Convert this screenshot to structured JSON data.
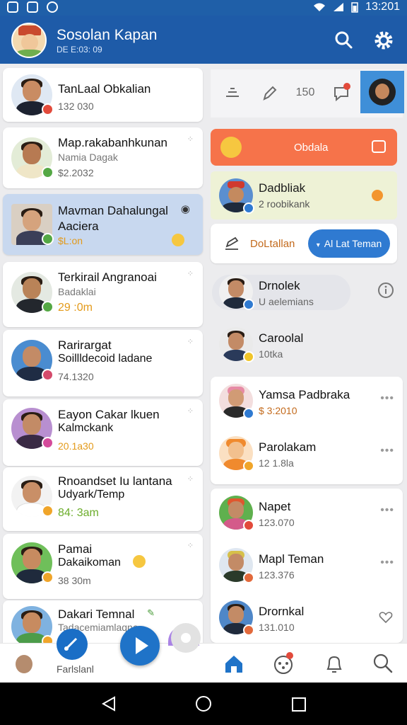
{
  "status": {
    "time": "13:201"
  },
  "header": {
    "title": "Sosolan Kapan",
    "subtitle": "DE E:03: 09"
  },
  "left_list": [
    {
      "name": "TanLaal Obkalian",
      "meta": "132 030"
    },
    {
      "name": "Map.rakabanhkunan",
      "sub": "Namia Dagak",
      "meta": "$2.2032"
    },
    {
      "name": "Mavman Dahalungal",
      "sub": "Aaciera",
      "meta": "$L:on"
    },
    {
      "name": "Terkirail Angranoai",
      "sub": "Badaklai",
      "meta": "29 :0m"
    },
    {
      "name": "Rarirargat",
      "sub": "Soillldecoid ladane",
      "meta": "74.1320"
    },
    {
      "name": "Eayon Cakar lkuen",
      "sub": "Kalmckank",
      "meta": "20.1a30"
    },
    {
      "name": "Rnoandset Iu lantana",
      "sub": "Udyark/Temp",
      "meta": "84: 3am"
    },
    {
      "name": "Pamai",
      "sub": "Dakaikoman",
      "meta": "38 30m"
    },
    {
      "name": "Dakari Temnal",
      "sub": "Tadacemiamlaqne"
    }
  ],
  "toolbar": {
    "count": "150"
  },
  "orange_banner": {
    "label": "Obdala"
  },
  "highlight": {
    "name": "Dadbliak",
    "meta": "2 roobikank"
  },
  "action_row": {
    "label": "DoLtallan",
    "button": "Al Lat Teman"
  },
  "right_list": [
    {
      "name": "Drnolek",
      "sub": "U aelemians"
    },
    {
      "name": "Caroolal",
      "sub": "10tka"
    },
    {
      "name": "Yamsa Padbraka",
      "sub": "$ 3:2010"
    },
    {
      "name": "Parolakam",
      "sub": "12 1.8la"
    },
    {
      "name": "Napet",
      "sub": "123.070"
    },
    {
      "name": "Mapl Teman",
      "sub": "123.376"
    },
    {
      "name": "Drornkal",
      "sub": "131.010"
    }
  ],
  "bottom_nav": {
    "label": "Farlslanl"
  },
  "colors": {
    "primary": "#1e5ba8",
    "accent": "#2f7ad1",
    "orange": "#f6734a",
    "selected": "#c8d8ef"
  }
}
